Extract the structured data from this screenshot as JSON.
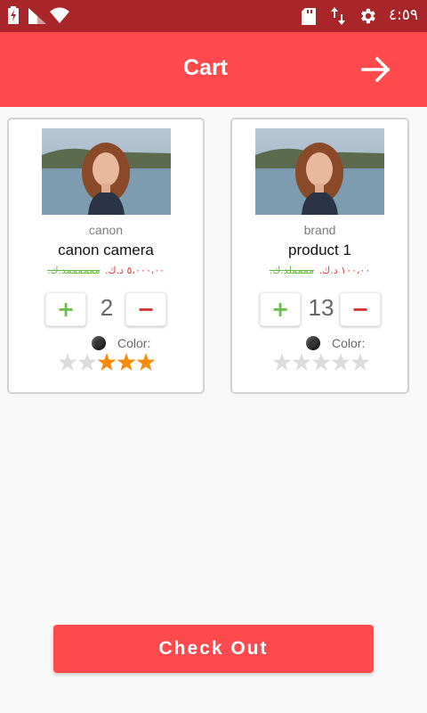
{
  "status_bar": {
    "time": "٤:٥٩",
    "icons": [
      "battery-charging-icon",
      "signal-icon",
      "wifi-icon",
      "sd-card-icon",
      "data-transfer-icon",
      "settings-icon"
    ]
  },
  "app_bar": {
    "title": "Cart",
    "action_icon": "arrow-right-icon"
  },
  "products": [
    {
      "brand": "canon",
      "name": "canon camera",
      "price": "٥،٠٠٠،٠٠ د.ك.",
      "old_price": "ممممممد.ك.",
      "quantity": "2",
      "plus_label": "+",
      "minus_label": "−",
      "color_label": "Color:",
      "color_value": "#333333",
      "rating": 3,
      "rating_max": 5
    },
    {
      "brand": "brand",
      "name": "product 1",
      "price": "١٠٠،٠٠ د.ك.",
      "old_price": "مممملد.ك.",
      "quantity": "13",
      "plus_label": "+",
      "minus_label": "−",
      "color_label": "Color:",
      "color_value": "#333333",
      "rating": 0,
      "rating_max": 5
    }
  ],
  "checkout": {
    "label": "Check Out"
  },
  "colors": {
    "primary": "#fe4a4d",
    "status_bar": "#a8262a",
    "star_filled": "#f58a0b",
    "star_empty": "#dcdcdc",
    "plus": "#6abf4b",
    "minus": "#d32f2f",
    "price": "#e53935",
    "old_price": "#66bb44"
  }
}
